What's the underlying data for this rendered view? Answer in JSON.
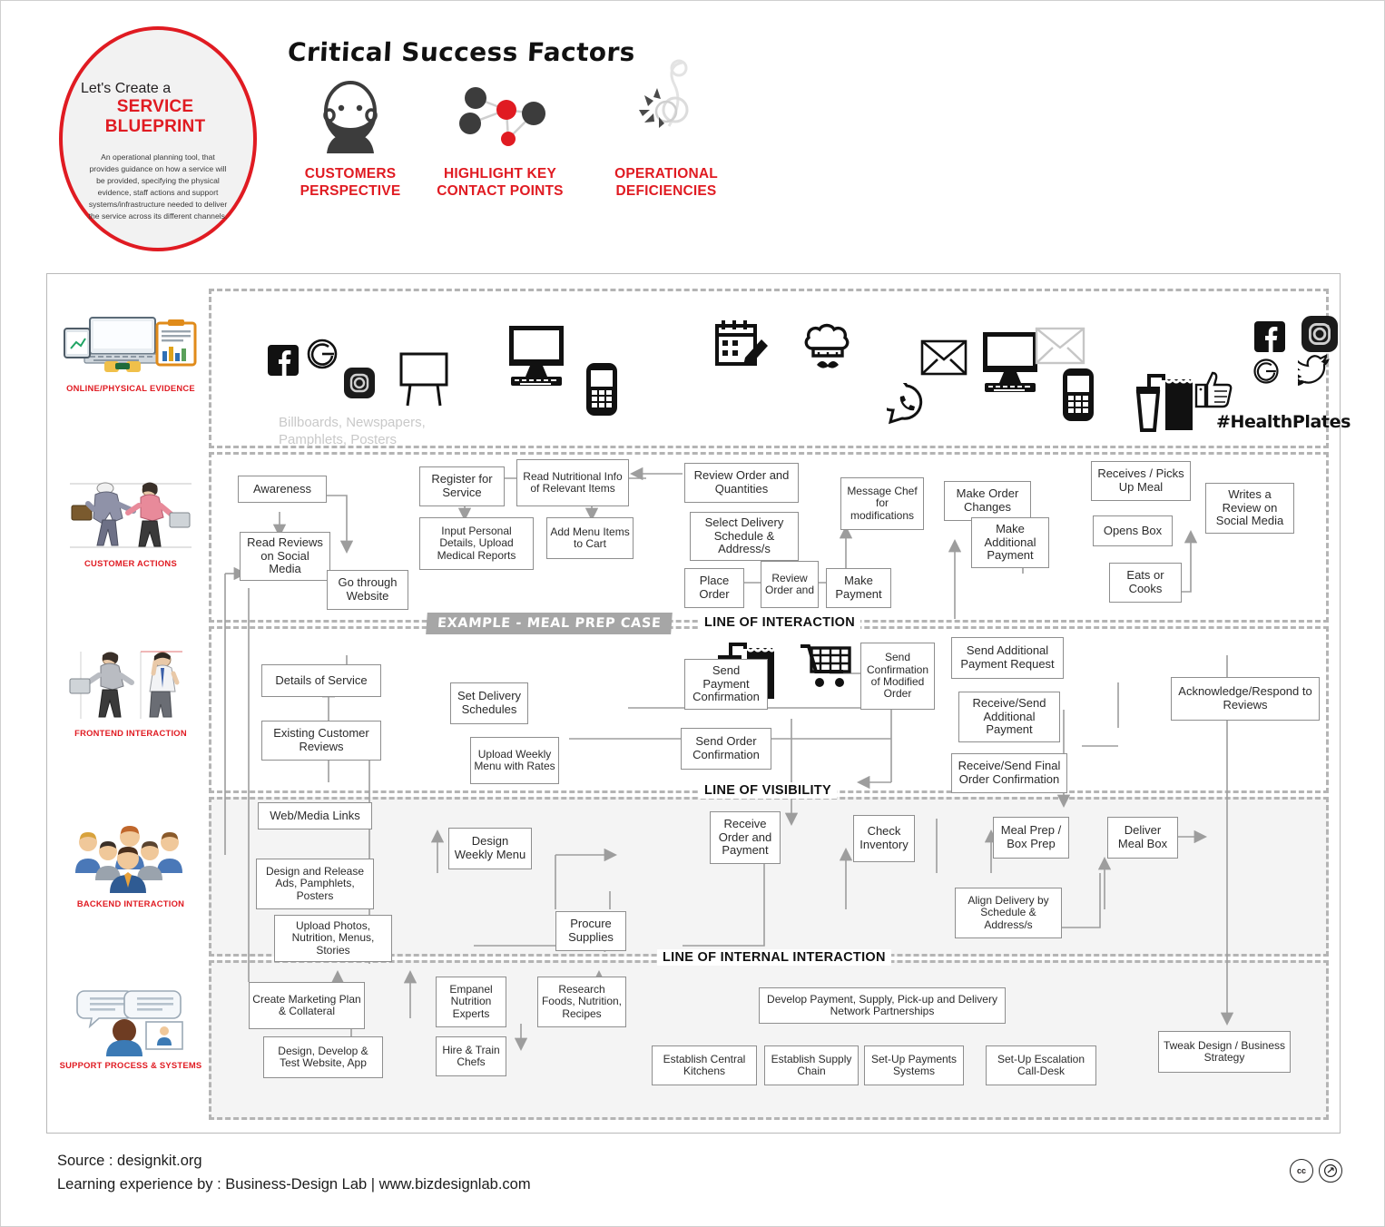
{
  "header": {
    "badge": {
      "line1": "Let's Create a",
      "line2": "SERVICE BLUEPRINT",
      "description": "An operational planning tool, that provides guidance on how a service will be provided, specifying the physical evidence, staff actions and support systems/infrastructure needed to deliver the service across its different channels."
    },
    "title": "Critical Success Factors",
    "factors": [
      {
        "icon": "bearded-person-icon",
        "label": "CUSTOMERS\nPERSPECTIVE",
        "line1": "CUSTOMERS",
        "line2": "PERSPECTIVE"
      },
      {
        "icon": "network-nodes-icon",
        "label": "HIGHLIGHT KEY\nCONTACT POINTS",
        "line1": "HIGHLIGHT KEY",
        "line2": "CONTACT POINTS"
      },
      {
        "icon": "broken-bulb-icon",
        "label": "OPERATIONAL\nDEFICIENCIES",
        "line1": "OPERATIONAL",
        "line2": "DEFICIENCIES"
      }
    ]
  },
  "colors": {
    "accent_red": "#e01b22",
    "node_border": "#8e8e8e",
    "band_dash": "#b4b4b4",
    "shade": "#f4f4f4",
    "chip_gray": "#a6a6a6",
    "muted_text": "#c9c9c9"
  },
  "rail": [
    {
      "id": "online-physical-evidence",
      "label": "ONLINE/PHYSICAL EVIDENCE",
      "art": "laptop-tablet-clipboard-art"
    },
    {
      "id": "customer-actions",
      "label": "CUSTOMER ACTIONS",
      "art": "two-business-people-art"
    },
    {
      "id": "frontend-interaction",
      "label": "FRONTEND INTERACTION",
      "art": "woman-and-man-art"
    },
    {
      "id": "backend-interaction",
      "label": "BACKEND INTERACTION",
      "art": "team-group-art"
    },
    {
      "id": "support-process-systems",
      "label": "SUPPORT PROCESS & SYSTEMS",
      "art": "support-agent-chat-art"
    }
  ],
  "lines": {
    "interaction": "LINE OF INTERACTION",
    "visibility": "LINE OF VISIBILITY",
    "internal": "LINE OF INTERNAL INTERACTION",
    "example_chip": "EXAMPLE - MEAL PREP CASE"
  },
  "evidence": {
    "note": "Billboards, Newspapers,\nPamphlets, Posters",
    "note_line1": "Billboards, Newspapers,",
    "note_line2": "Pamphlets, Posters",
    "hashtag": "#HealthPlates",
    "icons": [
      "facebook-icon",
      "google-icon",
      "instagram-icon",
      "billboard-icon",
      "desktop-computer-icon",
      "mobile-phone-icon",
      "calendar-edit-icon",
      "chef-hat-icon",
      "takeaway-bag-drink-icon",
      "shopping-cart-icon",
      "whatsapp-icon",
      "envelope-icon",
      "desktop-computer-icon",
      "mobile-phone-icon",
      "envelope-outline-icon",
      "takeaway-bag-drink-icon",
      "thumbs-up-icon",
      "facebook-icon",
      "instagram-icon",
      "google-icon",
      "twitter-bird-icon"
    ]
  },
  "nodes": {
    "customer_actions": [
      {
        "id": "awareness",
        "label": "Awareness"
      },
      {
        "id": "read-reviews-on-social-media",
        "label": "Read Reviews on Social Media"
      },
      {
        "id": "go-through-website",
        "label": "Go through Website"
      },
      {
        "id": "register-for-service",
        "label": "Register for Service"
      },
      {
        "id": "input-personal-details",
        "label": "Input Personal Details, Upload Medical Reports"
      },
      {
        "id": "read-nutritional-info",
        "label": "Read Nutritional Info of Relevant Items"
      },
      {
        "id": "add-menu-items-to-cart",
        "label": "Add Menu Items to Cart"
      },
      {
        "id": "review-order-and-quantities",
        "label": "Review Order and Quantities"
      },
      {
        "id": "select-delivery-schedule",
        "label": "Select Delivery Schedule & Address/s"
      },
      {
        "id": "place-order",
        "label": "Place Order"
      },
      {
        "id": "review-order-and",
        "label": "Review Order and"
      },
      {
        "id": "make-payment",
        "label": "Make Payment"
      },
      {
        "id": "message-chef-for-modifications",
        "label": "Message Chef for modifications"
      },
      {
        "id": "make-order-changes",
        "label": "Make Order Changes"
      },
      {
        "id": "make-additional-payment",
        "label": "Make Additional Payment"
      },
      {
        "id": "receives-picks-up-meal",
        "label": "Receives / Picks Up Meal"
      },
      {
        "id": "opens-box",
        "label": "Opens Box"
      },
      {
        "id": "eats-or-cooks",
        "label": "Eats or Cooks"
      },
      {
        "id": "writes-a-review-on-social-media",
        "label": "Writes a Review on Social Media"
      }
    ],
    "frontend_interaction": [
      {
        "id": "details-of-service",
        "label": "Details of Service"
      },
      {
        "id": "existing-customer-reviews",
        "label": "Existing Customer Reviews"
      },
      {
        "id": "set-delivery-schedules",
        "label": "Set Delivery Schedules"
      },
      {
        "id": "upload-weekly-menu-with-rates",
        "label": "Upload Weekly Menu with Rates"
      },
      {
        "id": "send-payment-confirmation",
        "label": "Send Payment Confirmation"
      },
      {
        "id": "send-order-confirmation",
        "label": "Send Order Confirmation"
      },
      {
        "id": "send-confirmation-of-modified-order",
        "label": "Send Confirmation of Modified Order"
      },
      {
        "id": "send-additional-payment-request",
        "label": "Send Additional Payment Request"
      },
      {
        "id": "receive-send-additional-payment",
        "label": "Receive/Send Additional Payment"
      },
      {
        "id": "receive-send-final-order-confirmation",
        "label": "Receive/Send Final Order Confirmation"
      },
      {
        "id": "acknowledge-respond-to-reviews",
        "label": "Acknowledge/Respond to Reviews"
      }
    ],
    "backend_interaction": [
      {
        "id": "web-media-links",
        "label": "Web/Media Links"
      },
      {
        "id": "design-and-release-ads",
        "label": "Design and Release Ads, Pamphlets, Posters"
      },
      {
        "id": "upload-photos-nutrition-menus-stories",
        "label": "Upload Photos, Nutrition, Menus, Stories"
      },
      {
        "id": "design-weekly-menu",
        "label": "Design Weekly Menu"
      },
      {
        "id": "procure-supplies",
        "label": "Procure Supplies"
      },
      {
        "id": "receive-order-and-payment",
        "label": "Receive Order and Payment"
      },
      {
        "id": "check-inventory",
        "label": "Check Inventory"
      },
      {
        "id": "meal-prep-box-prep",
        "label": "Meal Prep / Box Prep"
      },
      {
        "id": "deliver-meal-box",
        "label": "Deliver Meal Box"
      },
      {
        "id": "align-delivery-by-schedule",
        "label": "Align Delivery by Schedule & Address/s"
      }
    ],
    "support_process": [
      {
        "id": "create-marketing-plan-collateral",
        "label": "Create Marketing Plan & Collateral"
      },
      {
        "id": "design-develop-test-website-app",
        "label": "Design, Develop & Test Website, App"
      },
      {
        "id": "empanel-nutrition-experts",
        "label": "Empanel Nutrition Experts"
      },
      {
        "id": "hire-train-chefs",
        "label": "Hire & Train Chefs"
      },
      {
        "id": "research-foods-nutrition-recipes",
        "label": "Research Foods, Nutrition, Recipes"
      },
      {
        "id": "develop-payment-supply-partnerships",
        "label": "Develop Payment, Supply, Pick-up and Delivery Network Partnerships"
      },
      {
        "id": "establish-central-kitchens",
        "label": "Establish Central Kitchens"
      },
      {
        "id": "establish-supply-chain",
        "label": "Establish Supply Chain"
      },
      {
        "id": "set-up-payments-systems",
        "label": "Set-Up Payments Systems"
      },
      {
        "id": "set-up-escalation-call-desk",
        "label": "Set-Up Escalation Call-Desk"
      },
      {
        "id": "tweak-design-business-strategy",
        "label": "Tweak Design / Business Strategy"
      }
    ]
  },
  "footer": {
    "source": "Source : designkit.org",
    "learning": "Learning experience by : Business-Design Lab | www.bizdesignlab.com",
    "cc_badges": [
      "cc",
      "nd"
    ]
  }
}
